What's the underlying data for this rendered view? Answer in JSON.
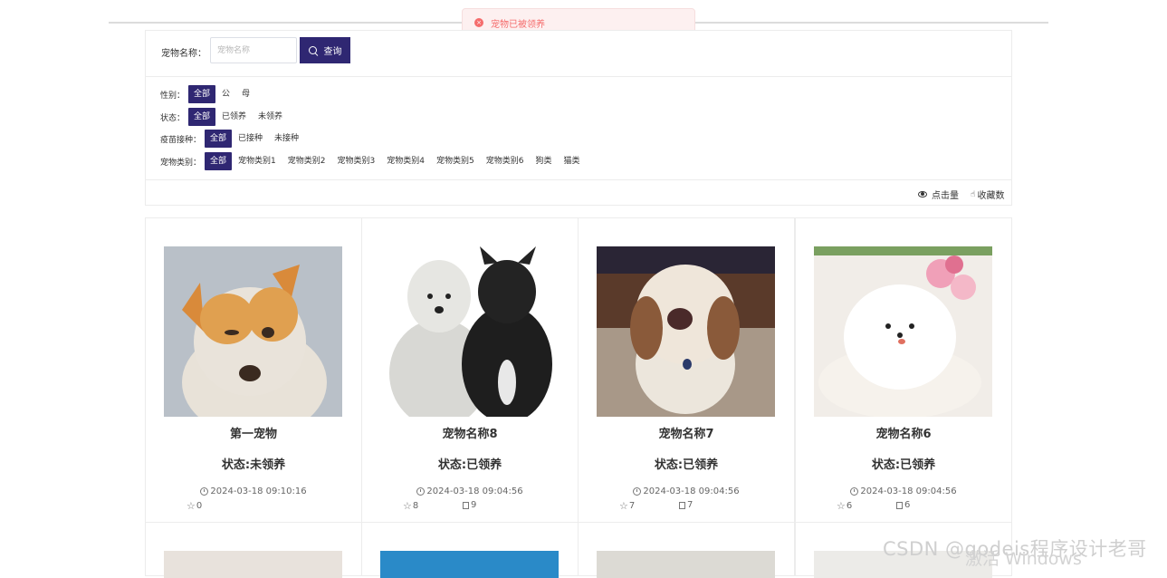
{
  "toast": {
    "message": "宠物已被领养",
    "icon": "close-circle-icon",
    "color": "#f56c6c"
  },
  "search": {
    "label": "宠物名称：",
    "placeholder": "宠物名称",
    "button_label": "查询"
  },
  "filters": {
    "gender": {
      "label": "性别：",
      "options": [
        "全部",
        "公",
        "母"
      ]
    },
    "status": {
      "label": "状态：",
      "options": [
        "全部",
        "已领养",
        "未领养"
      ]
    },
    "vaccine": {
      "label": "疫苗接种：",
      "options": [
        "全部",
        "已接种",
        "未接种"
      ]
    },
    "category": {
      "label": "宠物类别：",
      "options": [
        "全部",
        "宠物类别1",
        "宠物类别2",
        "宠物类别3",
        "宠物类别4",
        "宠物类别5",
        "宠物类别6",
        "狗类",
        "猫类"
      ]
    }
  },
  "sort": {
    "clicks_label": "点击量",
    "favorites_label": "收藏数"
  },
  "accent_color": "#2f2772",
  "cards": [
    {
      "name": "第一宠物",
      "status": "状态:未领养",
      "time": "2024-03-18 09:10:16",
      "stars": "0",
      "comments": ""
    },
    {
      "name": "宠物名称8",
      "status": "状态:已领养",
      "time": "2024-03-18 09:04:56",
      "stars": "8",
      "comments": "9"
    },
    {
      "name": "宠物名称7",
      "status": "状态:已领养",
      "time": "2024-03-18 09:04:56",
      "stars": "7",
      "comments": "7"
    },
    {
      "name": "宠物名称6",
      "status": "状态:已领养",
      "time": "2024-03-18 09:04:56",
      "stars": "6",
      "comments": "6"
    }
  ],
  "watermark": "CSDN @qodeis程序设计老哥",
  "activate_text": "激活 Windows"
}
